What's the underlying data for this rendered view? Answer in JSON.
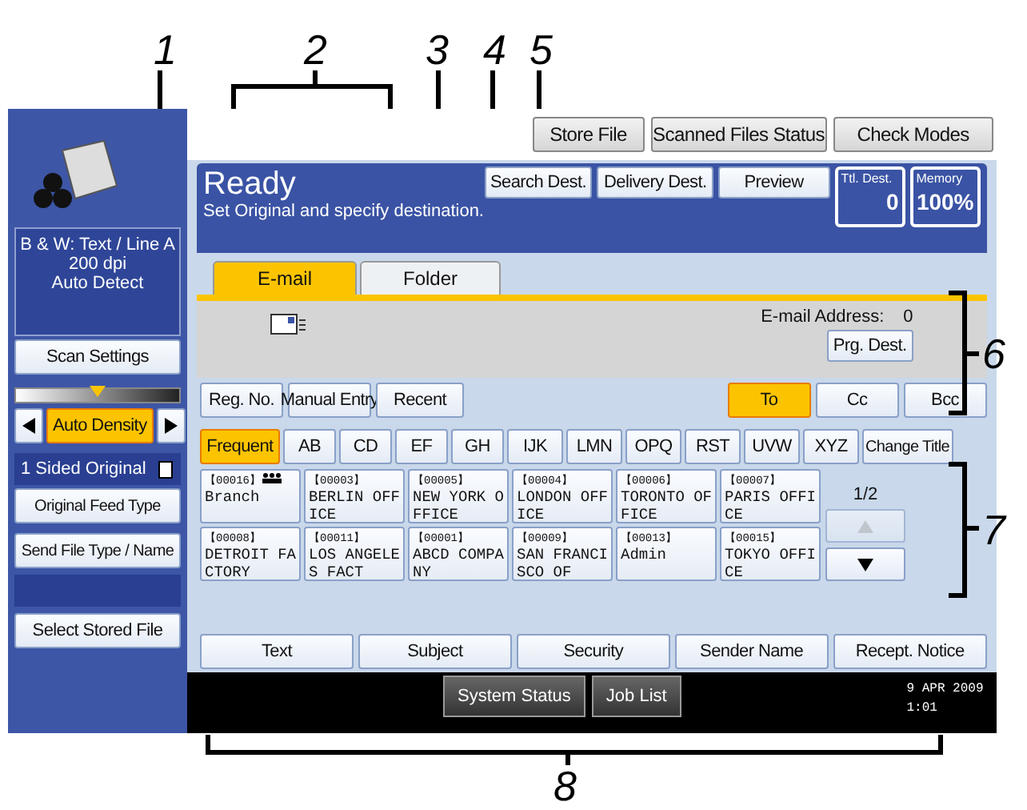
{
  "callouts": [
    "1",
    "2",
    "3",
    "4",
    "5",
    "6",
    "7",
    "8"
  ],
  "top_buttons": [
    "Store File",
    "Scanned Files Status",
    "Check Modes"
  ],
  "left_panel": {
    "scan_info": [
      "B & W: Text / Line A",
      "200 dpi",
      "Auto Detect"
    ],
    "scan_settings": "Scan Settings",
    "density": {
      "level": 0.5
    },
    "density_button": {
      "label": "Auto Density",
      "selected": true
    },
    "original": "1 Sided Original",
    "feed_type": "Original Feed Type",
    "send_file_type": "Send File Type / Name",
    "select_stored_file": "Select Stored File"
  },
  "status": {
    "title": "Ready",
    "message": "Set Original and specify destination."
  },
  "header_buttons": [
    "Search Dest.",
    "Delivery Dest.",
    "Preview"
  ],
  "counters": [
    {
      "label": "Ttl. Dest.",
      "value": "0"
    },
    {
      "label": "Memory",
      "value": "100%"
    }
  ],
  "tabs": [
    {
      "label": "E-mail",
      "selected": true
    },
    {
      "label": "Folder",
      "selected": false
    }
  ],
  "address": {
    "label": "E-mail Address:",
    "count": "0",
    "button": "Prg. Dest."
  },
  "entry_buttons": [
    "Reg. No.",
    "Manual Entry",
    "Recent"
  ],
  "recipient_types": [
    {
      "label": "To",
      "selected": true
    },
    {
      "label": "Cc",
      "selected": false
    },
    {
      "label": "Bcc",
      "selected": false
    }
  ],
  "index_tabs": [
    {
      "label": "Frequent",
      "selected": true
    },
    {
      "label": "AB",
      "selected": false
    },
    {
      "label": "CD",
      "selected": false
    },
    {
      "label": "EF",
      "selected": false
    },
    {
      "label": "GH",
      "selected": false
    },
    {
      "label": "IJK",
      "selected": false
    },
    {
      "label": "LMN",
      "selected": false
    },
    {
      "label": "OPQ",
      "selected": false
    },
    {
      "label": "RST",
      "selected": false
    },
    {
      "label": "UVW",
      "selected": false
    },
    {
      "label": "XYZ",
      "selected": false
    }
  ],
  "change_title": "Change Title",
  "destinations": [
    {
      "number": "【00016】",
      "name": "Branch",
      "group": true
    },
    {
      "number": "【00003】",
      "name": "BERLIN OFF ICE",
      "group": false
    },
    {
      "number": "【00005】",
      "name": "NEW YORK O FFICE",
      "group": false
    },
    {
      "number": "【00004】",
      "name": "LONDON OFF ICE",
      "group": false
    },
    {
      "number": "【00006】",
      "name": "TORONTO OF FICE",
      "group": false
    },
    {
      "number": "【00007】",
      "name": "PARIS OFFI CE",
      "group": false
    },
    {
      "number": "【00008】",
      "name": "DETROIT FA CTORY",
      "group": false
    },
    {
      "number": "【00011】",
      "name": "LOS ANGELE S FACT",
      "group": false
    },
    {
      "number": "【00001】",
      "name": "ABCD COMPA NY",
      "group": false
    },
    {
      "number": "【00009】",
      "name": "SAN FRANCI SCO OF",
      "group": false
    },
    {
      "number": "【00013】",
      "name": "Admin",
      "group": false
    },
    {
      "number": "【00015】",
      "name": "TOKYO OFFI CE",
      "group": false
    }
  ],
  "page": "1/2",
  "page_buttons": [
    {
      "kind": "up",
      "disabled": true
    },
    {
      "kind": "down",
      "disabled": false
    }
  ],
  "bottom_buttons": [
    "Text",
    "Subject",
    "Security",
    "Sender Name",
    "Recept. Notice"
  ],
  "system_bar": {
    "buttons": [
      "System Status",
      "Job List"
    ],
    "date": "9 APR  2009",
    "time": "1:01"
  }
}
